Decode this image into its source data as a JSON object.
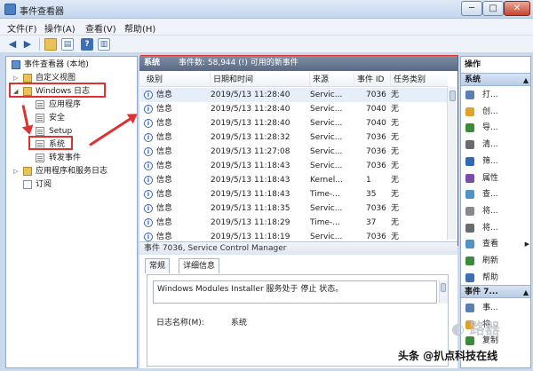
{
  "window": {
    "title": "事件查看器",
    "min": "─",
    "max": "□",
    "close": "✕"
  },
  "menu": [
    "文件(F)",
    "操作(A)",
    "查看(V)",
    "帮助(H)"
  ],
  "tree": {
    "root": "事件查看器 (本地)",
    "custom_views": "自定义视图",
    "windows_logs": "Windows 日志",
    "application": "应用程序",
    "security": "安全",
    "setup": "Setup",
    "system": "系统",
    "forwarded": "转发事件",
    "app_service_logs": "应用程序和服务日志",
    "subscriptions": "订阅"
  },
  "list": {
    "name": "系统",
    "info": "事件数: 58,944 (!) 可用的新事件",
    "columns": [
      "级别",
      "日期和时间",
      "来源",
      "事件 ID",
      "任务类别"
    ],
    "rows": [
      {
        "level": "信息",
        "time": "2019/5/13 11:28:40",
        "source": "Servic...",
        "id": "7036",
        "task": "无"
      },
      {
        "level": "信息",
        "time": "2019/5/13 11:28:40",
        "source": "Servic...",
        "id": "7040",
        "task": "无"
      },
      {
        "level": "信息",
        "time": "2019/5/13 11:28:40",
        "source": "Servic...",
        "id": "7040",
        "task": "无"
      },
      {
        "level": "信息",
        "time": "2019/5/13 11:28:32",
        "source": "Servic...",
        "id": "7036",
        "task": "无"
      },
      {
        "level": "信息",
        "time": "2019/5/13 11:27:08",
        "source": "Servic...",
        "id": "7036",
        "task": "无"
      },
      {
        "level": "信息",
        "time": "2019/5/13 11:18:43",
        "source": "Servic...",
        "id": "7036",
        "task": "无"
      },
      {
        "level": "信息",
        "time": "2019/5/13 11:18:43",
        "source": "Kernel...",
        "id": "1",
        "task": "无"
      },
      {
        "level": "信息",
        "time": "2019/5/13 11:18:43",
        "source": "Time-...",
        "id": "35",
        "task": "无"
      },
      {
        "level": "信息",
        "time": "2019/5/13 11:18:35",
        "source": "Servic...",
        "id": "7036",
        "task": "无"
      },
      {
        "level": "信息",
        "time": "2019/5/13 11:18:29",
        "source": "Time-...",
        "id": "37",
        "task": "无"
      },
      {
        "level": "信息",
        "time": "2019/5/13 11:18:19",
        "source": "Servic...",
        "id": "7036",
        "task": "无"
      }
    ]
  },
  "detail": {
    "header": "事件 7036, Service Control Manager",
    "tab_general": "常规",
    "tab_details": "详细信息",
    "message": "Windows Modules Installer 服务处于 停止 状态。",
    "log_name_label": "日志名称(M):",
    "log_name_value": "系统"
  },
  "actions": {
    "title": "操作",
    "section1": "系统",
    "items1": [
      "打...",
      "创...",
      "导...",
      "清...",
      "筛...",
      "属性",
      "查...",
      "将...",
      "将...",
      "查看",
      "刷新",
      "帮助"
    ],
    "section2": "事件 7...",
    "items2": [
      "事...",
      "将...",
      "复制"
    ]
  },
  "watermark": "头条 @扒点科技在线",
  "colors": {
    "highlight": "#e03030",
    "header": "#5a6a84",
    "info_icon": "#2f6ab5"
  }
}
